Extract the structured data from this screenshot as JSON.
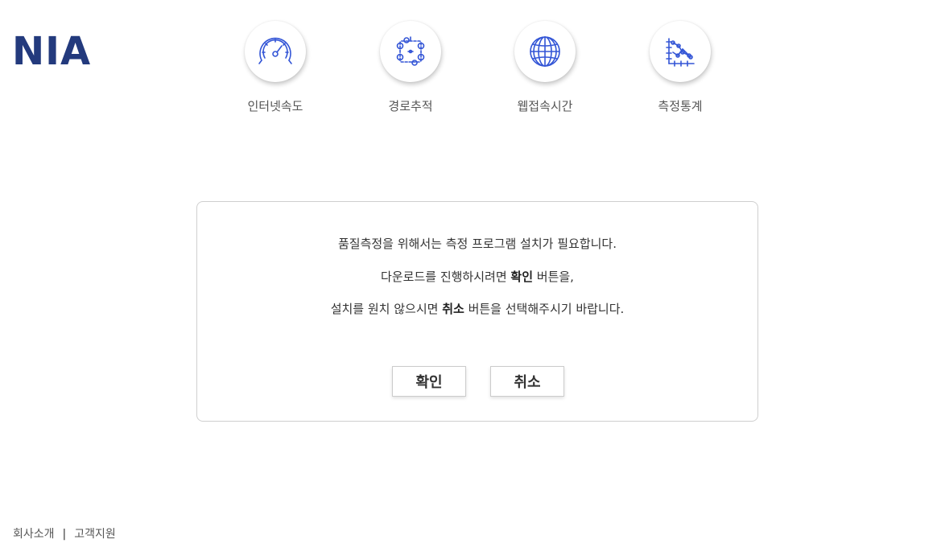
{
  "header": {
    "logo": "NIA"
  },
  "nav": {
    "items": [
      {
        "label": "인터넷속도",
        "icon": "speedometer-icon"
      },
      {
        "label": "경로추적",
        "icon": "route-trace-icon"
      },
      {
        "label": "웹접속시간",
        "icon": "globe-icon"
      },
      {
        "label": "측정통계",
        "icon": "statistics-chart-icon"
      }
    ]
  },
  "dialog": {
    "line1": "품질측정을 위해서는 측정 프로그램 설치가 필요합니다.",
    "line2_prefix": "다운로드를 진행하시려면 ",
    "line2_bold": "확인",
    "line2_suffix": " 버튼을,",
    "line3_prefix": "설치를 원치 않으시면 ",
    "line3_bold": "취소",
    "line3_suffix": " 버튼을 선택해주시기 바랍니다.",
    "confirm_label": "확인",
    "cancel_label": "취소"
  },
  "footer": {
    "links": [
      "회사소개",
      "고객지원"
    ],
    "separator": "|"
  },
  "colors": {
    "brand": "#233a7d",
    "icon_stroke": "#3355d6"
  }
}
